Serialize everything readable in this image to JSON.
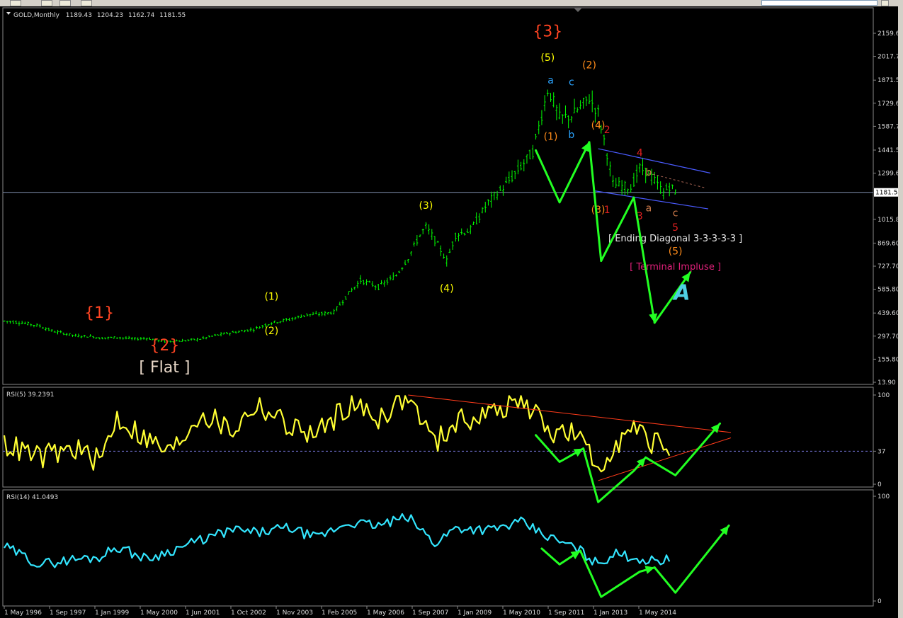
{
  "chart_data": [
    {
      "type": "line",
      "panel": "main",
      "title": "GOLD,Monthly",
      "ohlc": {
        "open": "1189.43",
        "high": "1204.23",
        "low": "1162.74",
        "close": "1181.55"
      },
      "y_ticks": [
        "2159.60",
        "2017.70",
        "1871.50",
        "1729.60",
        "1587.70",
        "1441.50",
        "1299.60",
        "1181.55",
        "1015.80",
        "869.60",
        "727.70",
        "585.80",
        "439.60",
        "297.70",
        "155.80",
        "13.90"
      ],
      "current_price": "1181.55",
      "ylim": [
        13.9,
        2190
      ],
      "x": [
        "1996-05",
        "1996-11",
        "1997-05",
        "1997-09",
        "1998-05",
        "1998-11",
        "1999-01",
        "1999-07",
        "2000-01",
        "2000-05",
        "2000-11",
        "2001-06",
        "2001-11",
        "2002-05",
        "2002-10",
        "2003-05",
        "2003-11",
        "2004-05",
        "2004-11",
        "2005-02",
        "2005-08",
        "2006-01",
        "2006-05",
        "2006-11",
        "2007-05",
        "2007-09",
        "2008-01",
        "2008-03",
        "2008-06",
        "2008-10",
        "2009-01",
        "2009-06",
        "2009-12",
        "2010-05",
        "2010-11",
        "2011-03",
        "2011-08",
        "2011-09",
        "2011-12",
        "2012-04",
        "2012-10",
        "2013-01",
        "2013-04",
        "2013-06",
        "2013-12",
        "2014-03",
        "2014-06",
        "2014-11",
        "2015-01",
        "2015-03"
      ],
      "values": [
        390,
        380,
        360,
        330,
        300,
        295,
        285,
        290,
        280,
        285,
        265,
        270,
        280,
        305,
        320,
        340,
        380,
        400,
        430,
        430,
        445,
        560,
        640,
        600,
        670,
        780,
        920,
        970,
        890,
        760,
        920,
        950,
        1120,
        1210,
        1340,
        1430,
        1810,
        1780,
        1640,
        1650,
        1760,
        1670,
        1420,
        1230,
        1210,
        1330,
        1300,
        1180,
        1220,
        1190
      ],
      "annotations": [
        {
          "text": "{1}",
          "x": "1999-01",
          "y": 410,
          "color": "#ff4422"
        },
        {
          "text": "{2}",
          "x": "2000-11",
          "y": 210,
          "color": "#ff4422"
        },
        {
          "text": "[ Flat ]",
          "x": "2000-11",
          "y": 75,
          "color": "#e8d8c8"
        },
        {
          "text": "(1)",
          "x": "2003-11",
          "y": 520,
          "color": "#ffff00"
        },
        {
          "text": "(2)",
          "x": "2003-11",
          "y": 310,
          "color": "#ffff00"
        },
        {
          "text": "(3)",
          "x": "2008-03",
          "y": 1080,
          "color": "#ffff00"
        },
        {
          "text": "(4)",
          "x": "2008-10",
          "y": 570,
          "color": "#ffff00"
        },
        {
          "text": "{3}",
          "x": "2011-08",
          "y": 2140,
          "color": "#ff4422"
        },
        {
          "text": "(5)",
          "x": "2011-08",
          "y": 1990,
          "color": "#ffff00"
        },
        {
          "text": "a",
          "x": "2011-09",
          "y": 1850,
          "color": "#2aa4ff"
        },
        {
          "text": "c",
          "x": "2012-04",
          "y": 1840,
          "color": "#2aa4ff"
        },
        {
          "text": "b",
          "x": "2012-04",
          "y": 1515,
          "color": "#2aa4ff"
        },
        {
          "text": "(1)",
          "x": "2011-09",
          "y": 1505,
          "color": "#ff8c1a"
        },
        {
          "text": "(2)",
          "x": "2012-10",
          "y": 1945,
          "color": "#ff8c1a"
        },
        {
          "text": "(4)",
          "x": "2013-01",
          "y": 1575,
          "color": "#ff8c1a"
        },
        {
          "text": "(3)",
          "x": "2013-01",
          "y": 1055,
          "color": "#ff8c1a"
        },
        {
          "text": "(5)",
          "x": "2015-03",
          "y": 800,
          "color": "#ff8c1a"
        },
        {
          "text": "2",
          "x": "2013-04",
          "y": 1545,
          "color": "#e02020"
        },
        {
          "text": "4",
          "x": "2014-03",
          "y": 1405,
          "color": "#e02020"
        },
        {
          "text": "1",
          "x": "2013-04",
          "y": 1055,
          "color": "#e02020"
        },
        {
          "text": "3",
          "x": "2014-03",
          "y": 1015,
          "color": "#e02020"
        },
        {
          "text": "5",
          "x": "2015-03",
          "y": 945,
          "color": "#e02020"
        },
        {
          "text": "b",
          "x": "2014-06",
          "y": 1285,
          "color": "#cc7a4a"
        },
        {
          "text": "a",
          "x": "2014-06",
          "y": 1065,
          "color": "#cc7a4a"
        },
        {
          "text": "c",
          "x": "2015-03",
          "y": 1035,
          "color": "#cc7a4a"
        },
        {
          "text": "[ Ending Diagonal 3-3-3-3-3 ]",
          "x": "2015-03",
          "y": 880,
          "color": "#e8e8e8"
        },
        {
          "text": "[ Terminal Impluse ]",
          "x": "2015-03",
          "y": 705,
          "color": "#e0207a"
        }
      ]
    },
    {
      "type": "line",
      "panel": "rsi5",
      "title": "RSI(5) 39.2391",
      "y_ticks": [
        "100",
        "37",
        "0"
      ],
      "ylim": [
        0,
        100
      ],
      "level": 37,
      "x": [
        "1996-05",
        "1997-05",
        "1998-05",
        "1999-01",
        "1999-07",
        "2000-05",
        "2001-01",
        "2001-11",
        "2002-10",
        "2003-06",
        "2004-05",
        "2005-02",
        "2006-01",
        "2006-11",
        "2007-09",
        "2008-06",
        "2009-01",
        "2010-01",
        "2010-11",
        "2011-09",
        "2012-06",
        "2013-01",
        "2013-06",
        "2014-01",
        "2014-06",
        "2015-01"
      ],
      "values": [
        45,
        30,
        40,
        25,
        75,
        50,
        35,
        80,
        60,
        90,
        65,
        55,
        90,
        75,
        100,
        45,
        70,
        80,
        95,
        60,
        55,
        15,
        45,
        60,
        50,
        40
      ]
    },
    {
      "type": "line",
      "panel": "rsi14",
      "title": "RSI(14) 41.0493",
      "y_ticks": [
        "100",
        "0"
      ],
      "ylim": [
        0,
        100
      ],
      "x": [
        "1996-05",
        "1997-05",
        "1998-05",
        "1999-01",
        "1999-07",
        "2000-05",
        "2001-01",
        "2001-11",
        "2002-10",
        "2003-06",
        "2004-05",
        "2005-02",
        "2006-01",
        "2006-11",
        "2007-09",
        "2008-06",
        "2009-01",
        "2010-01",
        "2010-11",
        "2011-09",
        "2012-06",
        "2013-01",
        "2013-06",
        "2014-01",
        "2014-06",
        "2015-01"
      ],
      "values": [
        52,
        35,
        40,
        42,
        52,
        40,
        48,
        58,
        68,
        65,
        70,
        60,
        75,
        72,
        80,
        55,
        70,
        68,
        75,
        60,
        50,
        35,
        45,
        42,
        38,
        40
      ]
    }
  ],
  "x_labels": [
    "1 May 1996",
    "1 Sep 1997",
    "1 Jan 1999",
    "1 May 2000",
    "1 Jun 2001",
    "1 Oct 2002",
    "1 Nov 2003",
    "1 Feb 2005",
    "1 May 2006",
    "1 Sep 2007",
    "1 Jan 2009",
    "1 May 2010",
    "1 Sep 2011",
    "1 Jan 2013",
    "1 May 2014"
  ],
  "colors": {
    "price": "#00ff00",
    "rsi5": "#ffff33",
    "rsi14": "#33e6ff",
    "arrows": "#22ff22",
    "wedge": "#4a5bff",
    "rsi_trend": "#ff3b1a",
    "watermark": "#4ecfe3"
  },
  "watermark_icon": "stylized-A-logo-icon"
}
